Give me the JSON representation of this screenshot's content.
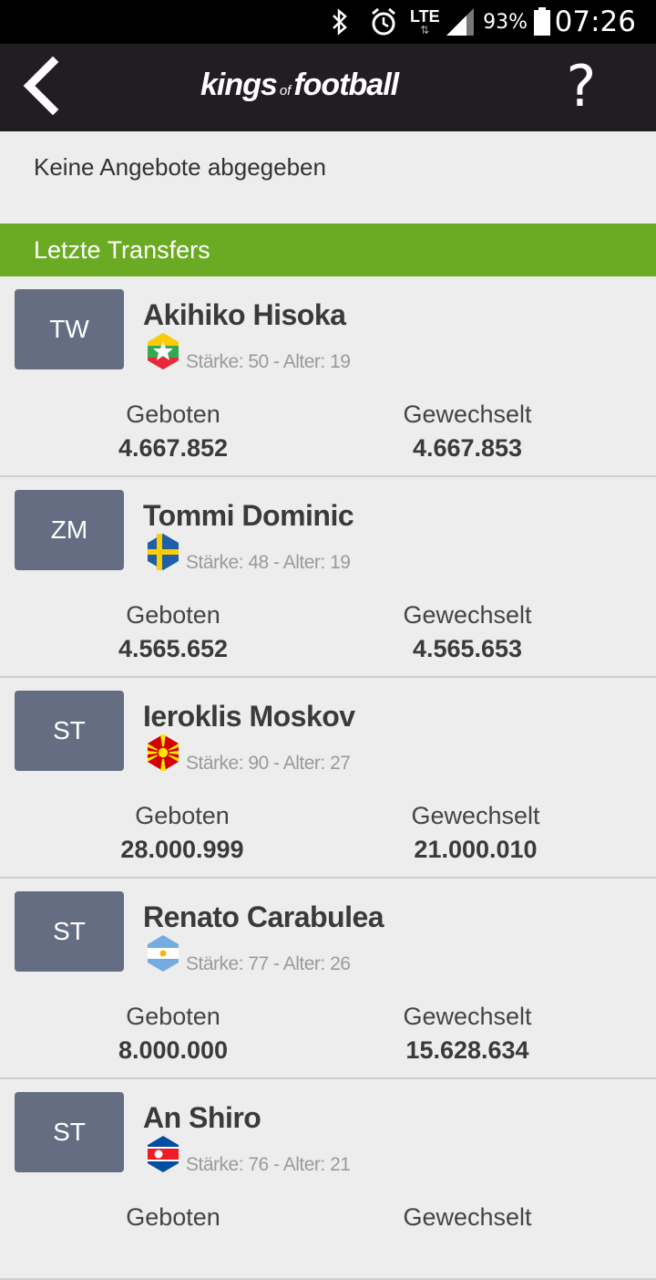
{
  "status_bar": {
    "network": "LTE",
    "battery_percent": "93%",
    "time": "07:26"
  },
  "app_bar": {
    "logo": {
      "part1": "kings",
      "part2": "of",
      "part3": "football"
    },
    "help_label": "?"
  },
  "offers": {
    "message": "Keine Angebote abgegeben"
  },
  "section": {
    "title": "Letzte Transfers"
  },
  "transfers": [
    {
      "position": "TW",
      "name": "Akihiko Hisoka",
      "flag": "myanmar-flag-icon",
      "stats": "Stärke: 50 - Alter: 19",
      "bid_label": "Geboten",
      "bid_value": "4.667.852",
      "transfer_label": "Gewechselt",
      "transfer_value": "4.667.853"
    },
    {
      "position": "ZM",
      "name": "Tommi Dominic",
      "flag": "sweden-flag-icon",
      "stats": "Stärke: 48 - Alter: 19",
      "bid_label": "Geboten",
      "bid_value": "4.565.652",
      "transfer_label": "Gewechselt",
      "transfer_value": "4.565.653"
    },
    {
      "position": "ST",
      "name": "Ieroklis Moskov",
      "flag": "macedonia-flag-icon",
      "stats": "Stärke: 90 - Alter: 27",
      "bid_label": "Geboten",
      "bid_value": "28.000.999",
      "transfer_label": "Gewechselt",
      "transfer_value": "21.000.010"
    },
    {
      "position": "ST",
      "name": "Renato Carabulea",
      "flag": "argentina-flag-icon",
      "stats": "Stärke: 77 - Alter: 26",
      "bid_label": "Geboten",
      "bid_value": "8.000.000",
      "transfer_label": "Gewechselt",
      "transfer_value": "15.628.634"
    },
    {
      "position": "ST",
      "name": "An Shiro",
      "flag": "north-korea-flag-icon",
      "stats": "Stärke: 76 - Alter: 21",
      "bid_label": "Geboten",
      "bid_value": "",
      "transfer_label": "Gewechselt",
      "transfer_value": ""
    }
  ],
  "colors": {
    "app_bar": "#221c23",
    "accent_green": "#6aab23",
    "badge": "#646d82"
  }
}
